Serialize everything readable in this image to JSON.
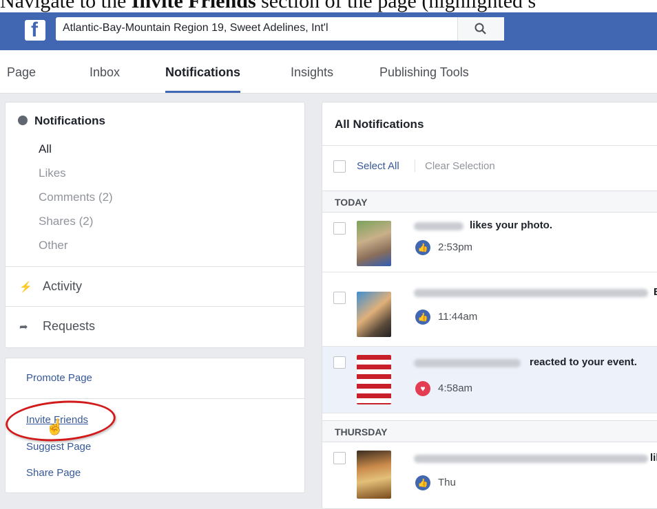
{
  "caption": {
    "prefix": "Navigate to the ",
    "bold": "Invite Friends",
    "suffix": " section of the page (highlighted s"
  },
  "topbar": {
    "logo": "f",
    "search_value": "Atlantic-Bay-Mountain Region 19, Sweet Adelines, Int'l",
    "search_icon": "search-icon"
  },
  "tabs": [
    "Page",
    "Inbox",
    "Notifications",
    "Insights",
    "Publishing Tools"
  ],
  "left_panel": {
    "header": "Notifications",
    "filters": [
      "All",
      "Likes",
      "Comments (2)",
      "Shares (2)",
      "Other"
    ],
    "sections": [
      "Activity",
      "Requests"
    ]
  },
  "left_links": {
    "promote": "Promote Page",
    "invite": "Invite Friends",
    "suggest": "Suggest Page",
    "share": "Share Page"
  },
  "notifications": {
    "header": "All Notifications",
    "select_all": "Select All",
    "clear_selection": "Clear Selection",
    "groups": [
      {
        "label": "TODAY",
        "items": [
          {
            "text": "likes your photo.",
            "time": "2:53pm",
            "reaction": "like"
          },
          {
            "text": "B",
            "time": "11:44am",
            "reaction": "like"
          },
          {
            "text": "reacted to your event.",
            "time": "4:58am",
            "reaction": "love"
          }
        ]
      },
      {
        "label": "THURSDAY",
        "items": [
          {
            "text": "lil",
            "time": "Thu",
            "reaction": "like"
          }
        ]
      }
    ]
  },
  "colors": {
    "brand": "#4267b2",
    "link": "#365899",
    "highlight": "#d21a1a"
  }
}
